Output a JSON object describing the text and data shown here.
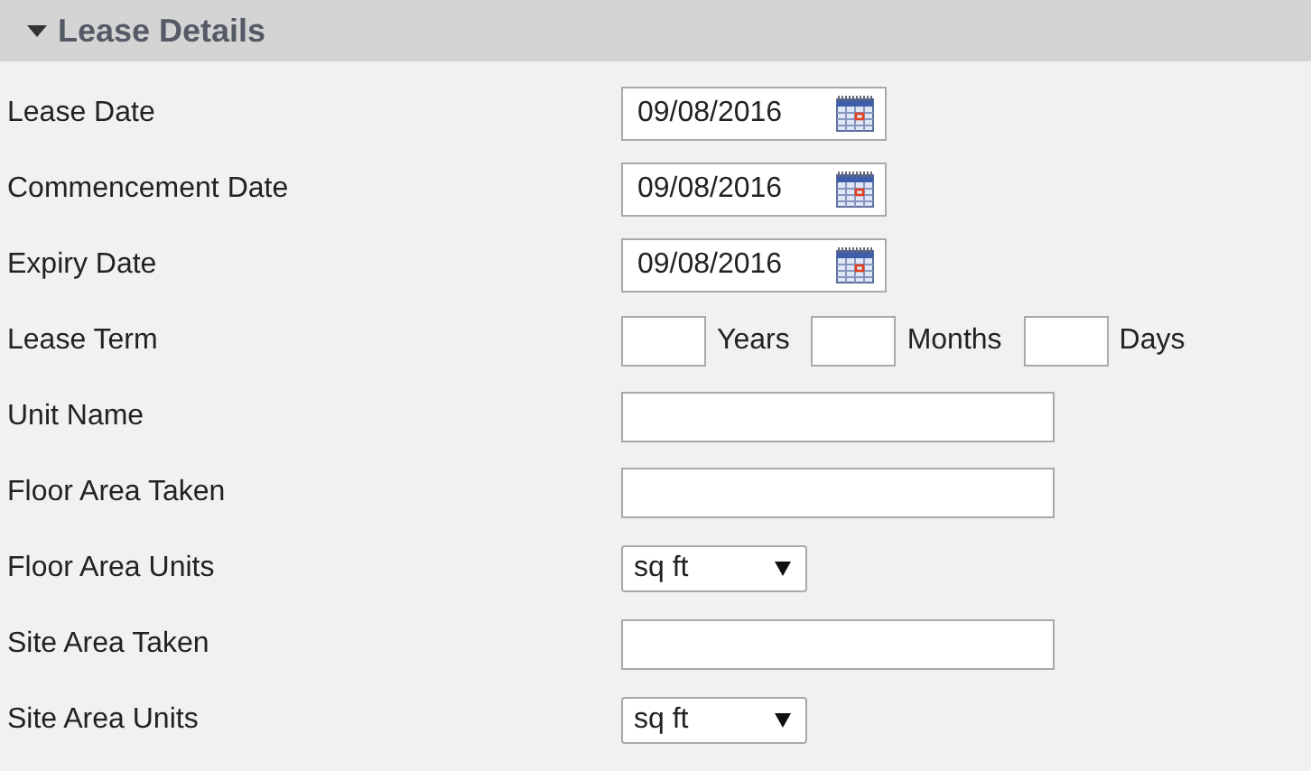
{
  "section": {
    "title": "Lease Details",
    "expanded": true
  },
  "rows": [
    {
      "label": "Lease Date",
      "kind": "date",
      "value": "09/08/2016"
    },
    {
      "label": "Commencement Date",
      "kind": "date",
      "value": "09/08/2016"
    },
    {
      "label": "Expiry Date",
      "kind": "date",
      "value": "09/08/2016"
    },
    {
      "label": "Lease Term",
      "kind": "term",
      "units": [
        "Years",
        "Months",
        "Days"
      ]
    },
    {
      "label": "Unit Name",
      "kind": "text"
    },
    {
      "label": "Floor Area Taken",
      "kind": "text"
    },
    {
      "label": "Floor Area Units",
      "kind": "select",
      "value": "sq ft"
    },
    {
      "label": "Site Area Taken",
      "kind": "text"
    },
    {
      "label": "Site Area Units",
      "kind": "select",
      "value": "sq ft"
    }
  ]
}
